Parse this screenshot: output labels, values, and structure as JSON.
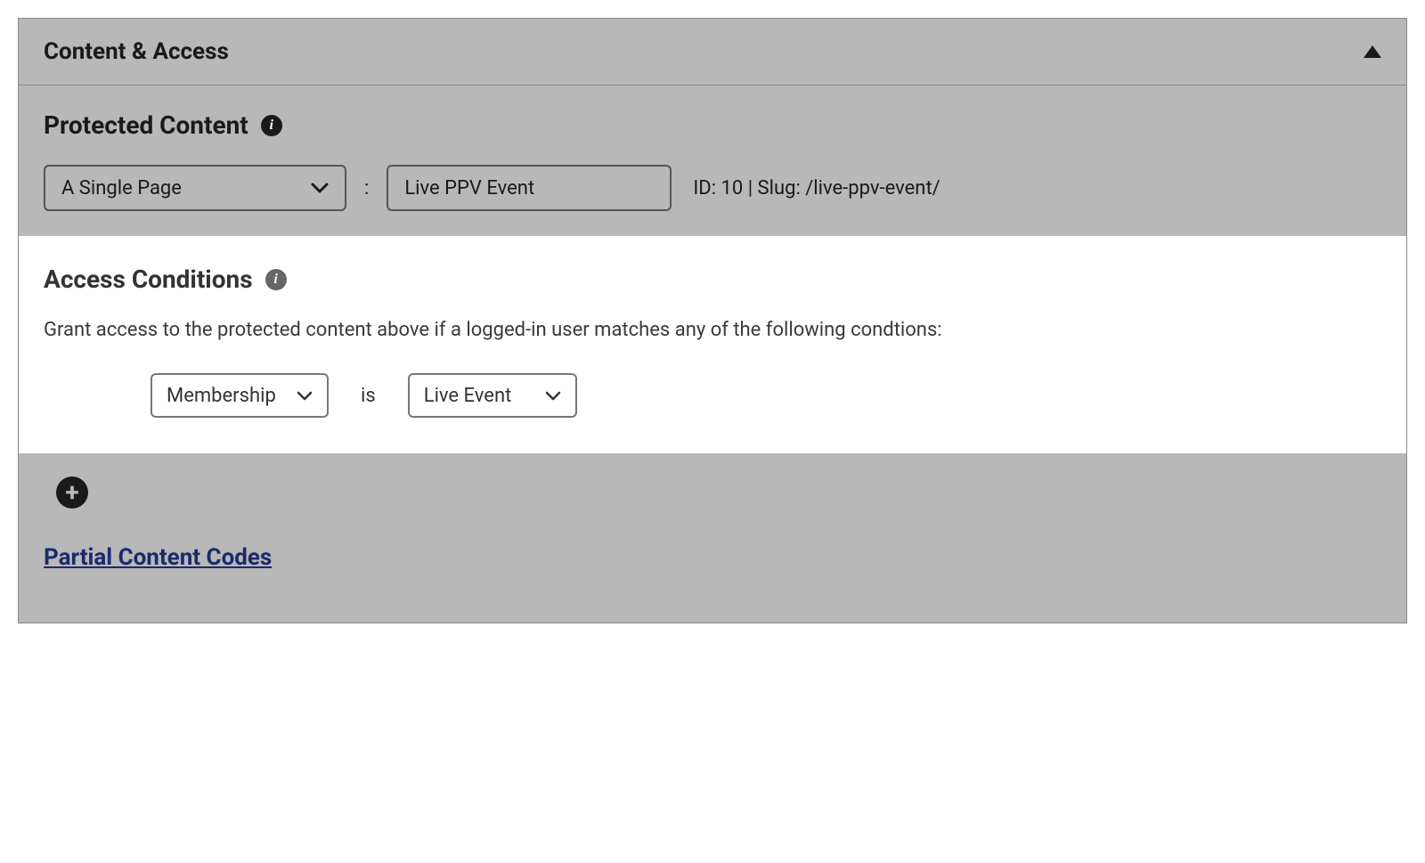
{
  "panel": {
    "title": "Content & Access"
  },
  "protected": {
    "heading": "Protected Content",
    "type_select": "A Single Page",
    "colon": ":",
    "item_select": "Live PPV Event",
    "meta": "ID: 10 | Slug: /live-ppv-event/"
  },
  "access": {
    "heading": "Access Conditions",
    "description": "Grant access to the protected content above if a logged-in user matches any of the following condtions:",
    "condition": {
      "field": "Membership",
      "operator": "is",
      "value": "Live Event"
    }
  },
  "link": "Partial Content Codes",
  "icons": {
    "info": "i"
  }
}
